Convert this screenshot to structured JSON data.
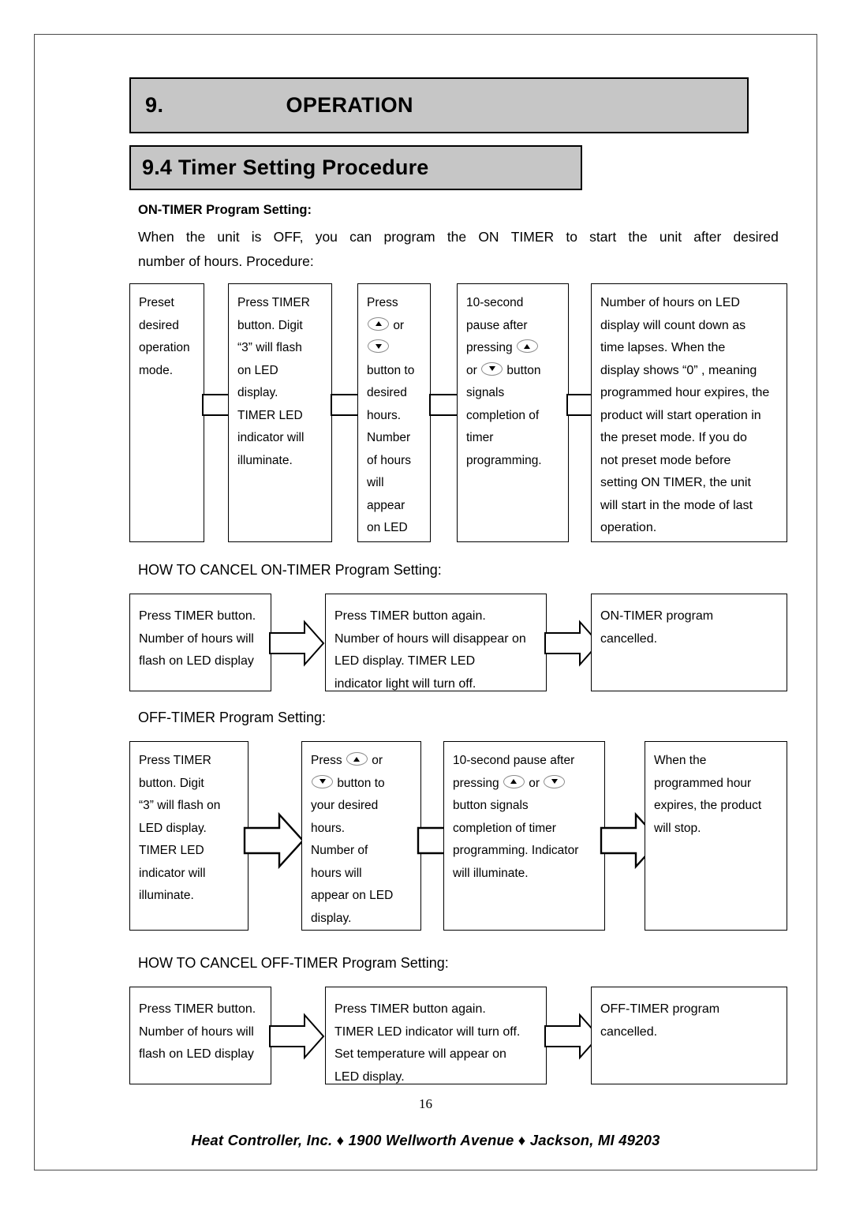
{
  "header": {
    "chapter_number": "9.",
    "chapter_title": "OPERATION",
    "section_title": "9.4 Timer Setting Procedure"
  },
  "on_timer": {
    "subhead": "ON-TIMER Program Setting:",
    "intro_line1": "When the unit is OFF, you can program the ON TIMER to start the unit after desired",
    "intro_line2": "number of hours.   Procedure:",
    "intro_words_line1": [
      "When",
      "the",
      "unit",
      "is",
      "OFF,",
      "you",
      "can",
      "program",
      "the",
      "ON",
      "TIMER",
      "to",
      "start",
      "the",
      "unit",
      "after",
      "desired"
    ],
    "steps": [
      {
        "id": "preset-mode",
        "lines": [
          "Preset",
          "desired",
          "operation",
          "mode."
        ]
      },
      {
        "id": "press-timer",
        "lines": [
          "Press TIMER",
          "button. Digit",
          "“3” will flash",
          "on LED",
          "display.",
          "TIMER LED",
          "indicator will",
          "illuminate."
        ]
      },
      {
        "id": "press-updown",
        "lines_pre": [
          "Press"
        ],
        "lines_post": [
          "button to",
          "desired",
          "hours.",
          "Number",
          "of hours",
          "will",
          "appear",
          "on LED"
        ],
        "or_label": "or"
      },
      {
        "id": "ten-second-pause",
        "line1": "10-second",
        "line2": "pause after",
        "line3_pre": "pressing",
        "line4_pre": "or",
        "line4_post": "button",
        "lines_tail": [
          "signals",
          "completion of",
          "timer",
          "programming."
        ]
      },
      {
        "id": "countdown-result",
        "lines": [
          "Number of hours on LED",
          "display will count down as",
          "time lapses.   When the",
          "display shows “0” , meaning",
          "programmed hour expires, the",
          "product will start operation in",
          "the preset mode.   If you do",
          "not preset mode before",
          "setting ON TIMER, the unit",
          "will start in the mode of last",
          "operation."
        ]
      }
    ]
  },
  "cancel_on_timer": {
    "label": "HOW TO CANCEL ON-TIMER Program Setting:",
    "steps": [
      {
        "id": "press-timer-cancel",
        "lines": [
          "Press TIMER button.",
          "Number of hours will",
          "flash on LED display"
        ]
      },
      {
        "id": "press-timer-again",
        "lines": [
          "Press TIMER button again.",
          "Number of hours will disappear on",
          "LED display.   TIMER LED",
          "indicator light will turn off."
        ]
      },
      {
        "id": "on-timer-cancelled",
        "lines": [
          "ON-TIMER program",
          "cancelled."
        ]
      }
    ]
  },
  "off_timer": {
    "label": "OFF-TIMER Program Setting:",
    "steps": [
      {
        "id": "press-timer-off",
        "lines": [
          "Press TIMER",
          "button.   Digit",
          "“3” will flash on",
          "LED display.",
          "TIMER LED",
          "indicator will",
          "illuminate."
        ]
      },
      {
        "id": "press-updown-off",
        "line1_pre": "Press",
        "line1_post": "or",
        "line2_post": "button to",
        "lines_tail": [
          "your desired",
          "hours.",
          "Number of",
          "hours will",
          "appear on LED",
          "display."
        ]
      },
      {
        "id": "ten-second-pause-off",
        "line1": "10-second pause after",
        "line2_pre": "pressing",
        "line2_mid": "or",
        "lines_tail": [
          "button signals",
          "completion of timer",
          "programming. Indicator",
          "will illuminate."
        ]
      },
      {
        "id": "product-stops",
        "lines": [
          "When the",
          "programmed hour",
          "expires, the product",
          "will stop."
        ]
      }
    ]
  },
  "cancel_off_timer": {
    "label": "HOW TO CANCEL OFF-TIMER Program Setting:",
    "steps": [
      {
        "id": "press-timer-cancel-off",
        "lines": [
          "Press TIMER button.",
          "Number of hours will",
          "flash on LED display"
        ]
      },
      {
        "id": "press-timer-again-off",
        "lines": [
          "Press TIMER button again.",
          "TIMER LED indicator will turn off.",
          "Set temperature will appear on",
          "LED display."
        ]
      },
      {
        "id": "off-timer-cancelled",
        "lines": [
          "OFF-TIMER program",
          "cancelled."
        ]
      }
    ]
  },
  "footer": {
    "page_number": "16",
    "company": "Heat Controller, Inc.",
    "diamond": "♦",
    "address": "1900 Wellworth Avenue",
    "city_state_zip": "Jackson, MI   49203"
  },
  "colors": {
    "header_bar_fill": "#c6c6c6",
    "border": "#000000",
    "page_border": "#4a4a4a"
  }
}
